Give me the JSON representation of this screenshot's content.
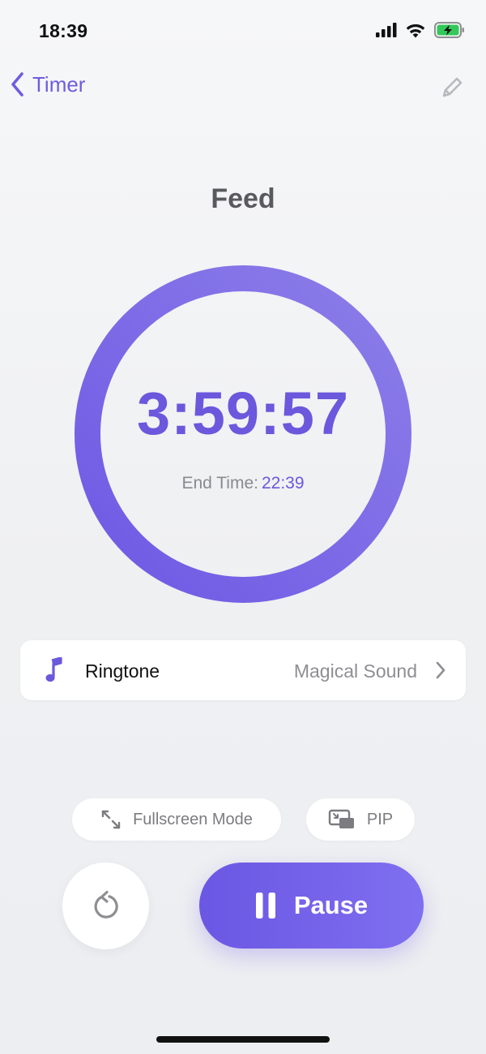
{
  "status_bar": {
    "time": "18:39",
    "icons": [
      "cellular-signal-icon",
      "wifi-icon",
      "battery-charging-icon"
    ]
  },
  "nav": {
    "back_label": "Timer",
    "back_icon": "chevron-left-icon",
    "edit_icon": "pencil-icon"
  },
  "timer": {
    "title": "Feed",
    "countdown": "3:59:57",
    "end_time_label": "End Time:",
    "end_time_value": "22:39"
  },
  "ringtone": {
    "icon": "music-note-icon",
    "label": "Ringtone",
    "value": "Magical Sound"
  },
  "modes": {
    "fullscreen_label": "Fullscreen Mode",
    "pip_label": "PIP"
  },
  "controls": {
    "reset_icon": "reset-arrow-icon",
    "pause_label": "Pause"
  },
  "colors": {
    "accent": "#6a58dd",
    "accent_light": "#8a7cea",
    "battery_green": "#34c759"
  }
}
